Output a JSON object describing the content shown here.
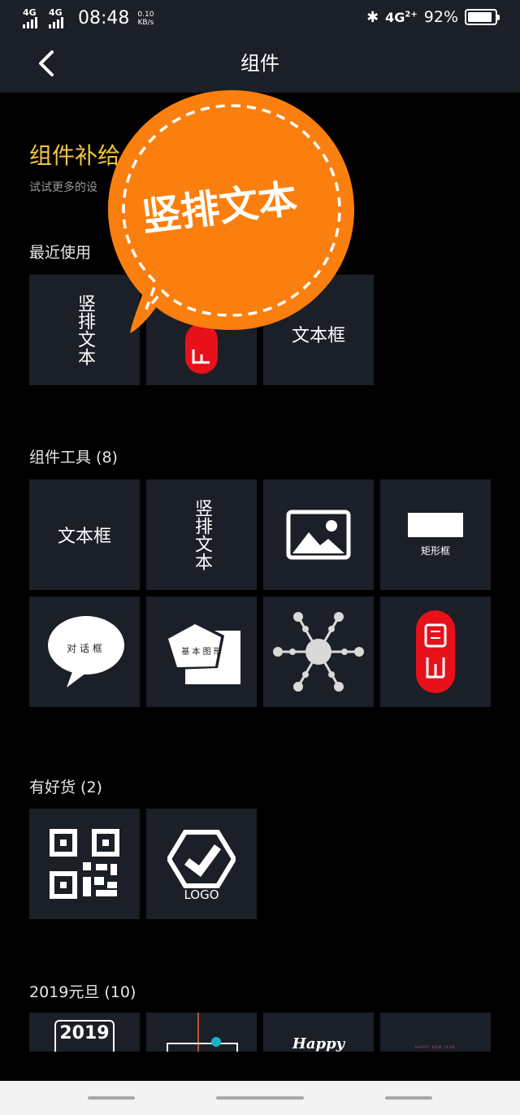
{
  "status_bar": {
    "signal_1": "4G",
    "signal_2": "4G",
    "time": "08:48",
    "speed_value": "0.10",
    "speed_unit": "KB/s",
    "bluetooth": "bluetooth-icon",
    "network": "4G",
    "network_sub": "2+",
    "battery": "92%",
    "battery_level": 0.92
  },
  "nav": {
    "title": "组件",
    "back_icon": "chevron-left-icon"
  },
  "banner": {
    "title": "组件补给",
    "subtitle": "试试更多的设"
  },
  "overlay": {
    "text": "竖排文本",
    "color": "#fb7f0e"
  },
  "sections": {
    "recent": {
      "title": "最近使用"
    },
    "tools": {
      "title": "组件工具 (8)"
    },
    "goods": {
      "title": "有好货 (2)"
    },
    "newyear": {
      "title": "2019元旦 (10)"
    }
  },
  "recent": {
    "vertical_text": "竖排文本",
    "textbox": "文本框"
  },
  "tools": {
    "textbox": "文本框",
    "vertical_text": "竖排文本",
    "rectangle": "矩形框",
    "dialog": "对 话 框",
    "basic_shape": "基 本 图 形"
  },
  "goods": {
    "logo": "LOGO"
  },
  "newyear": {
    "year": "2019",
    "happy": "Happy",
    "header_text": "HAPPY NEW YEAR"
  },
  "colors": {
    "tile_bg": "#1b1f27",
    "accent_yellow": "#f2c53d",
    "seal_red": "#e8101b"
  }
}
